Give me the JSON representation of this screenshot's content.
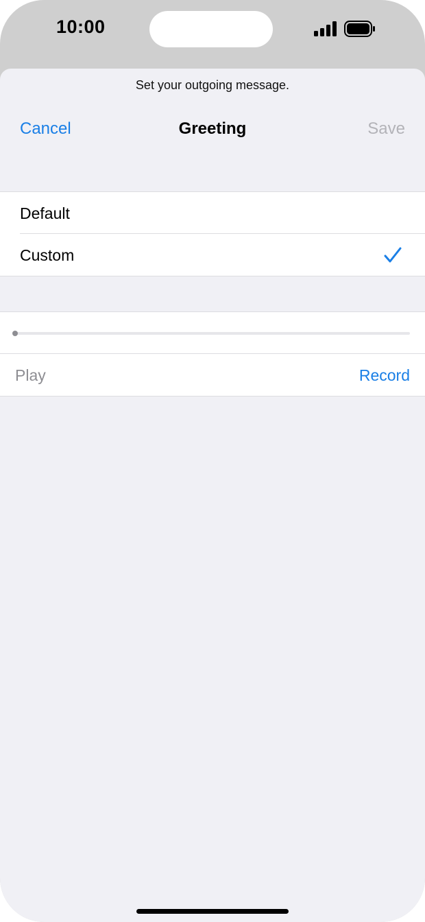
{
  "status_bar": {
    "time": "10:00",
    "signal_icon": "cellular-signal-icon",
    "battery_icon": "battery-full-icon"
  },
  "sheet": {
    "subtitle": "Set your outgoing message."
  },
  "nav": {
    "cancel_label": "Cancel",
    "title": "Greeting",
    "save_label": "Save"
  },
  "greeting_options": [
    {
      "label": "Default",
      "selected": false
    },
    {
      "label": "Custom",
      "selected": true
    }
  ],
  "player": {
    "progress": 0,
    "play_label": "Play",
    "record_label": "Record"
  },
  "colors": {
    "accent": "#1a7fe6",
    "disabled": "#b3b3b8",
    "background": "#f0f0f5"
  }
}
